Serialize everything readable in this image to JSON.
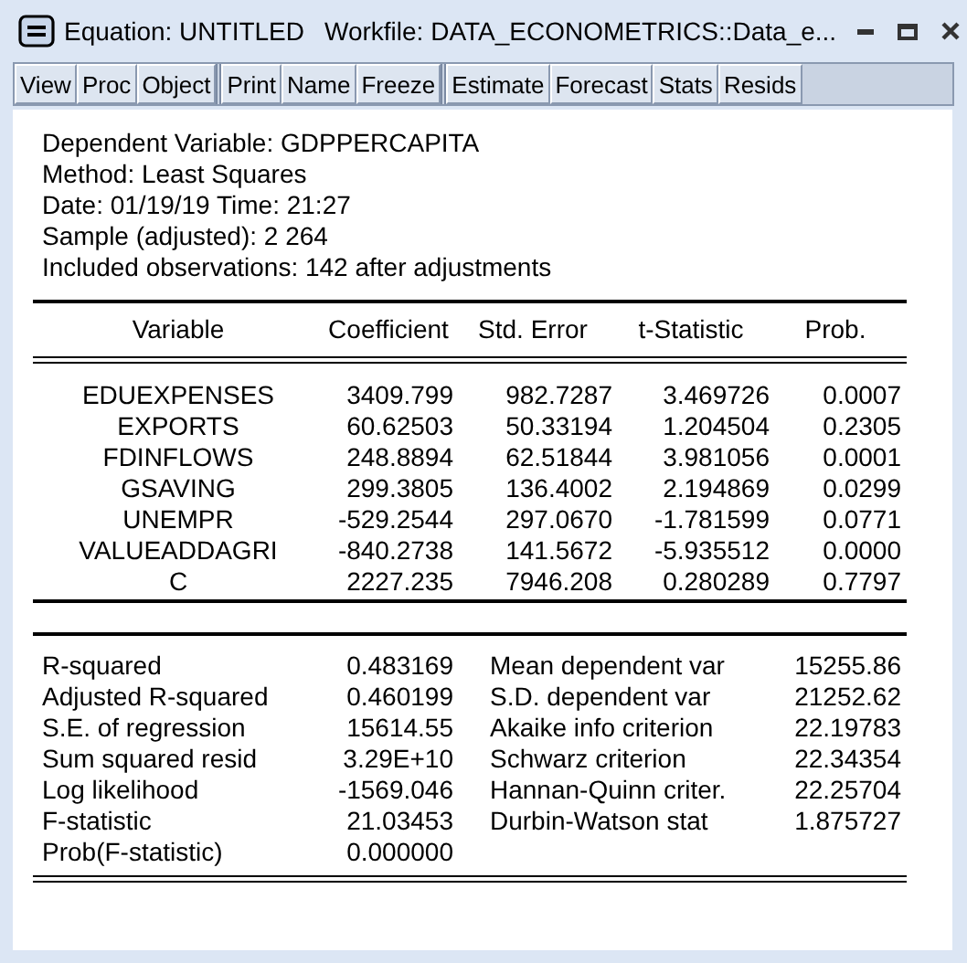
{
  "window": {
    "title": "Equation: UNTITLED",
    "workfile": "Workfile: DATA_ECONOMETRICS::Data_e..."
  },
  "toolbar": [
    [
      "View",
      "Proc",
      "Object"
    ],
    [
      "Print",
      "Name",
      "Freeze"
    ],
    [
      "Estimate",
      "Forecast",
      "Stats",
      "Resids"
    ]
  ],
  "header_lines": [
    "Dependent Variable: GDPPERCAPITA",
    "Method: Least Squares",
    "Date: 01/19/19   Time: 21:27",
    "Sample (adjusted): 2 264",
    "Included observations: 142 after adjustments"
  ],
  "table": {
    "columns": [
      "Variable",
      "Coefficient",
      "Std. Error",
      "t-Statistic",
      "Prob."
    ],
    "rows": [
      [
        "EDUEXPENSES",
        "3409.799",
        "982.7287",
        "3.469726",
        "0.0007"
      ],
      [
        "EXPORTS",
        "60.62503",
        "50.33194",
        "1.204504",
        "0.2305"
      ],
      [
        "FDINFLOWS",
        "248.8894",
        "62.51844",
        "3.981056",
        "0.0001"
      ],
      [
        "GSAVING",
        "299.3805",
        "136.4002",
        "2.194869",
        "0.0299"
      ],
      [
        "UNEMPR",
        "-529.2544",
        "297.0670",
        "-1.781599",
        "0.0771"
      ],
      [
        "VALUEADDAGRI",
        "-840.2738",
        "141.5672",
        "-5.935512",
        "0.0000"
      ],
      [
        "C",
        "2227.235",
        "7946.208",
        "0.280289",
        "0.7797"
      ]
    ]
  },
  "stats": {
    "left": [
      {
        "label": "R-squared",
        "value": "0.483169"
      },
      {
        "label": "Adjusted R-squared",
        "value": "0.460199"
      },
      {
        "label": "S.E. of regression",
        "value": "15614.55"
      },
      {
        "label": "Sum squared resid",
        "value": "3.29E+10"
      },
      {
        "label": "Log likelihood",
        "value": "-1569.046"
      },
      {
        "label": "F-statistic",
        "value": "21.03453"
      },
      {
        "label": "Prob(F-statistic)",
        "value": "0.000000"
      }
    ],
    "right": [
      {
        "label": "Mean dependent var",
        "value": "15255.86"
      },
      {
        "label": "S.D. dependent var",
        "value": "21252.62"
      },
      {
        "label": "Akaike info criterion",
        "value": "22.19783"
      },
      {
        "label": "Schwarz criterion",
        "value": "22.34354"
      },
      {
        "label": "Hannan-Quinn criter.",
        "value": "22.25704"
      },
      {
        "label": "Durbin-Watson stat",
        "value": "1.875727"
      }
    ]
  }
}
